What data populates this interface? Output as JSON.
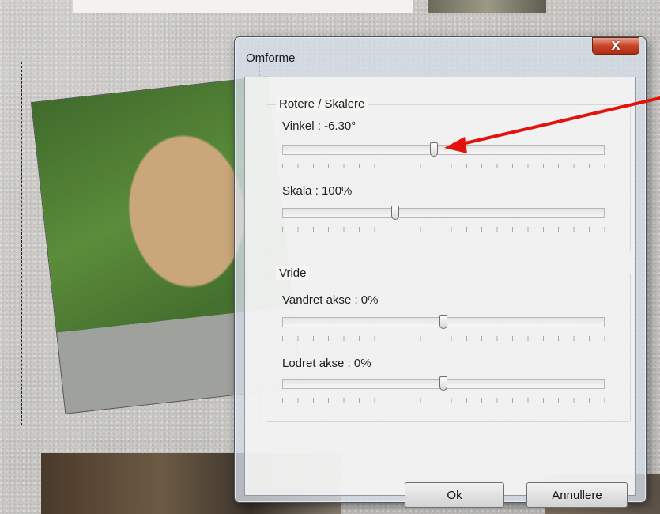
{
  "dialog": {
    "title": "Omforme",
    "close_icon": "close-icon",
    "ok_label": "Ok",
    "cancel_label": "Annullere"
  },
  "groups": {
    "rotate_scale": {
      "title": "Rotere / Skalere",
      "angle_label": "Vinkel : -6.30°",
      "angle_slider_fraction": 0.47,
      "scale_label": "Skala : 100%",
      "scale_slider_fraction": 0.35
    },
    "skew": {
      "title": "Vride",
      "horizontal_label": "Vandret akse : 0%",
      "horizontal_slider_fraction": 0.5,
      "vertical_label": "Lodret akse : 0%",
      "vertical_slider_fraction": 0.5
    }
  },
  "colors": {
    "annotation_arrow": "#e3120b",
    "close_button": "#c9452a"
  }
}
